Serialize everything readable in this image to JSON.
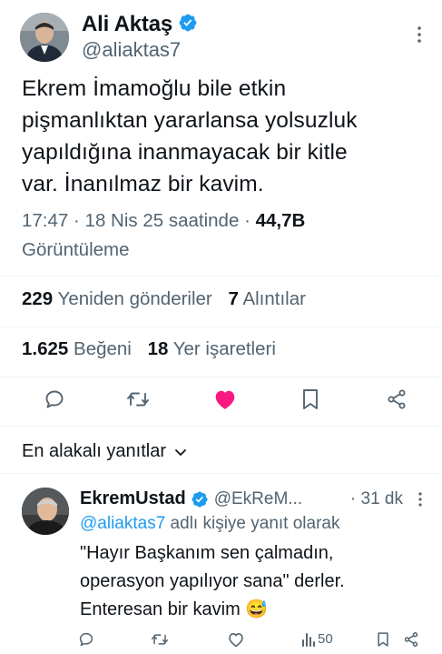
{
  "author": {
    "name": "Ali Aktaş",
    "handle": "@aliaktas7"
  },
  "tweet": {
    "text_lines": [
      "Ekrem İmamoğlu bile etkin",
      "pişmanlıktan yararlansa yolsuzluk",
      "yapıldığına inanmayacak bir kitle",
      "var. İnanılmaz bir kavim."
    ],
    "time": "17:47",
    "date": "18 Nis 25 saatinde",
    "views": "44,7B",
    "views_label": "Görüntüleme"
  },
  "stats": {
    "retweets": "229",
    "retweets_label": "Yeniden gönderiler",
    "quotes": "7",
    "quotes_label": "Alıntılar",
    "likes": "1.625",
    "likes_label": "Beğeni",
    "bookmarks": "18",
    "bookmarks_label": "Yer işaretleri"
  },
  "section": {
    "title": "En alakalı yanıtlar"
  },
  "reply": {
    "name": "EkremUstad",
    "handle": "@EkReM...",
    "time": "· 31 dk",
    "replying_to_handle": "@aliaktas7",
    "replying_to_suffix": " adlı kişiye yanıt olarak",
    "text_lines": [
      "\"Hayır Başkanım sen çalmadın,",
      "operasyon yapılıyor sana\" derler.",
      "Enteresan bir kavim 😅"
    ],
    "views": "50"
  },
  "colors": {
    "accent": "#1d9bf0",
    "like": "#f91880",
    "text": "#0f1419",
    "muted": "#536471"
  }
}
